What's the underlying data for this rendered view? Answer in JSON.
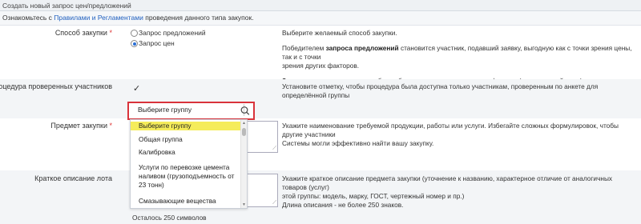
{
  "header": {
    "title": "Создать новый запрос цен/предложений"
  },
  "notice": {
    "prefix": "Ознакомьтесь с ",
    "link": "Правилами и Регламентами",
    "suffix": " проведения данного типа закупок."
  },
  "form": {
    "method": {
      "label": "Способ закупки",
      "required_mark": "*",
      "options": [
        "Запрос предложений",
        "Запрос цен"
      ],
      "selected": "Запрос цен",
      "help_line1": "Выберите желаемый способ закупки.",
      "help_p2_pre": "Победителем ",
      "help_p2_bold": "запроса предложений",
      "help_p2_post": " становится участник, подавший заявку, выгодную как с точки зрения цены, так и с точки",
      "help_p2_line2": "зрения других факторов.",
      "help_p3_bold": "Запрос цен",
      "help_p3_post": " подразумевает выбор победителя строго по ценовому фактору (минимальной цене)."
    },
    "verified": {
      "label": "Процедура проверенных участников",
      "checked_glyph": "✓",
      "help": "Установите отметку, чтобы процедура была доступна только участникам, проверенным по анкете для определённой группы"
    },
    "group_search": {
      "value": "Выберите группу",
      "options": [
        "Выберите группу",
        "Общая группа",
        "Калибровка",
        "Услуги по перевозке цемента наливом (грузоподъемность от 23 тонн)",
        "Смазывающие вещества"
      ],
      "selected": "Выберите группу"
    },
    "subject": {
      "label": "Предмет закупки",
      "required_mark": "*",
      "help_line1": "Укажите наименование требуемой продукции, работы или услуги. Избегайте сложных формулировок, чтобы другие участники",
      "help_line2": "Системы могли эффективно найти вашу закупку."
    },
    "description": {
      "label": "Краткое описание лота",
      "help_line1": "Укажите краткое описание предмета закупки (уточнение к названию, характерное отличие от аналогичных товаров (услуг)",
      "help_line2": "этой группы: модель, марку, ГОСТ, чертежный номер и пр.)",
      "help_line3": "Длина описания - не более 250 знаков.",
      "counter": "Осталось 250 символов"
    }
  }
}
